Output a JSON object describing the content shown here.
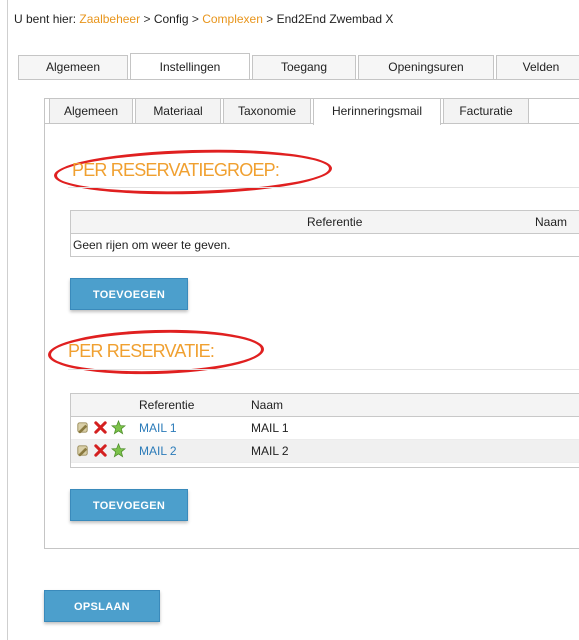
{
  "breadcrumb": {
    "prefix": "U bent hier:",
    "items": [
      "Zaalbeheer",
      "Config",
      "Complexen",
      "End2End Zwembad X"
    ],
    "separator": ">"
  },
  "top_tabs": [
    "Algemeen",
    "Instellingen",
    "Toegang",
    "Openingsuren",
    "Velden"
  ],
  "top_tabs_active": "Instellingen",
  "sub_tabs": [
    "Algemeen",
    "Materiaal",
    "Taxonomie",
    "Herinneringsmail",
    "Facturatie"
  ],
  "sub_tabs_active": "Herinneringsmail",
  "section_group": {
    "title": "PER RESERVATIEGROEP:",
    "columns": [
      "Referentie",
      "Naam"
    ],
    "empty_message": "Geen rijen om weer te geven.",
    "add_label": "TOEVOEGEN"
  },
  "section_reservation": {
    "title": "PER RESERVATIE:",
    "columns": [
      "Referentie",
      "Naam"
    ],
    "rows": [
      {
        "referentie": "MAIL 1",
        "naam": "MAIL 1"
      },
      {
        "referentie": "MAIL 2",
        "naam": "MAIL 2"
      }
    ],
    "add_label": "TOEVOEGEN"
  },
  "save_label": "OPSLAAN",
  "icons": {
    "row_actions": [
      "edit-pencil-icon",
      "delete-x-icon",
      "star-icon"
    ]
  },
  "colors": {
    "accent_orange": "#f0a030",
    "link_orange": "#e8951c",
    "link_blue": "#2b7bb9",
    "button_blue": "#4c9fcc",
    "highlight_red": "#e02020"
  }
}
